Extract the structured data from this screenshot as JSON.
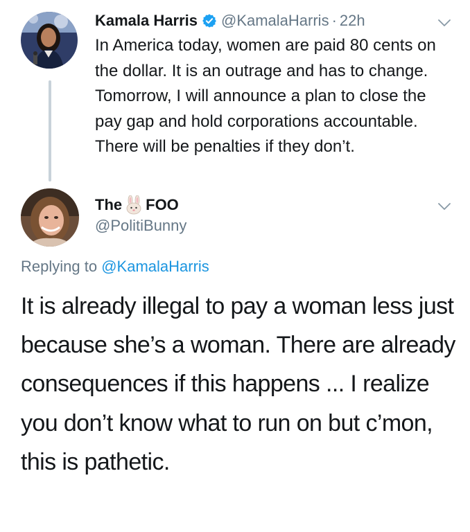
{
  "tweet1": {
    "display_name": "Kamala Harris",
    "verified_icon": "verified-badge-icon",
    "handle": "@KamalaHarris",
    "separator": "·",
    "timestamp": "22h",
    "menu_icon": "chevron-down-icon",
    "text": "In America today, women are paid 80 cents on the dollar. It is an outrage and has to change. Tomorrow, I will announce a plan to close the pay gap and hold corporations accountable. There will be penalties if they don’t."
  },
  "tweet2": {
    "name_part1": "The",
    "name_emoji": "rabbit-face-icon",
    "name_part2": "FOO",
    "handle": "@PolitiBunny",
    "menu_icon": "chevron-down-icon",
    "replying_prefix": "Replying to",
    "replying_to": "@KamalaHarris",
    "text": "It is already illegal to pay a woman less just because she’s a woman. There are already consequences if this happens ... I realize you don’t know what to run on but c’mon, this is pathetic."
  },
  "colors": {
    "text_primary": "#14171a",
    "text_secondary": "#657786",
    "link": "#1b95e0",
    "verified": "#1da1f2",
    "thread_line": "#c8d2da"
  }
}
